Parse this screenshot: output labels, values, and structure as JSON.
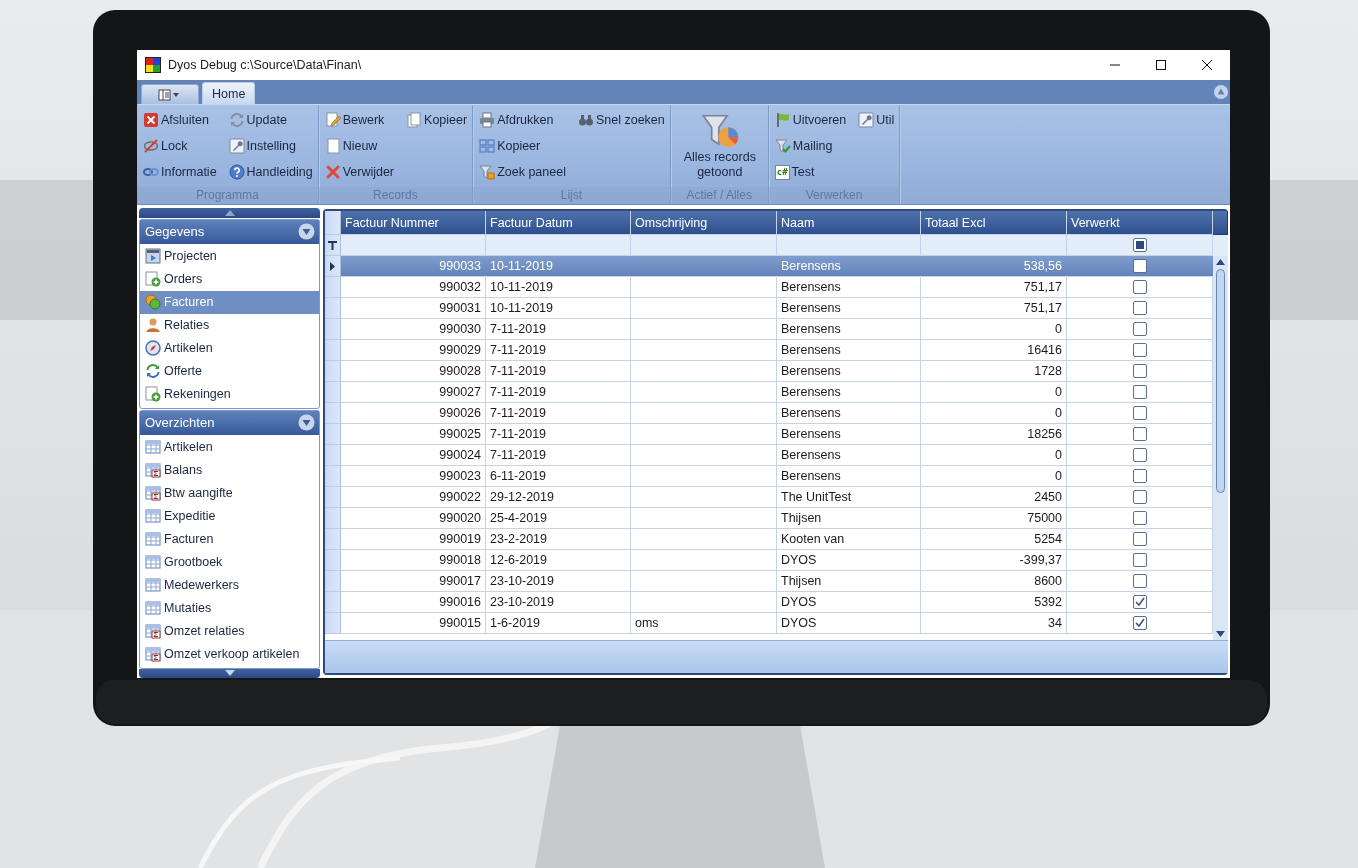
{
  "window": {
    "title": "Dyos Debug c:\\Source\\Data\\Finan\\"
  },
  "ribbon": {
    "tabs": [
      {
        "label": "Home",
        "selected": true
      }
    ],
    "groups": [
      {
        "label": "Programma",
        "columns": [
          [
            {
              "label": "Afsluiten",
              "kind": "delete"
            },
            {
              "label": "Lock",
              "kind": "crossed-eye"
            },
            {
              "label": "Informatie",
              "kind": "chain"
            }
          ],
          [
            {
              "label": "Update",
              "kind": "refresh"
            },
            {
              "label": "Instelling",
              "kind": "wrench"
            },
            {
              "label": "Handleiding",
              "kind": "help"
            }
          ]
        ]
      },
      {
        "label": "Records",
        "columns": [
          [
            {
              "label": "Bewerk",
              "kind": "edit"
            },
            {
              "label": "Nieuw",
              "kind": "page"
            },
            {
              "label": "Verwijder",
              "kind": "cross"
            }
          ],
          [
            {
              "label": "Kopieer",
              "kind": "copy"
            }
          ]
        ]
      },
      {
        "label": "Lijst",
        "columns": [
          [
            {
              "label": "Afdrukken",
              "kind": "printer"
            },
            {
              "label": "Kopieer",
              "kind": "tiles"
            },
            {
              "label": "Zoek paneel",
              "kind": "funnel"
            }
          ],
          [
            {
              "label": "Snel zoeken",
              "kind": "binoculars"
            }
          ]
        ]
      },
      {
        "label": "Actief / Alles",
        "large": {
          "label": "Alles records getoond",
          "kind": "funnel-chart"
        }
      },
      {
        "label": "Verwerken",
        "columns": [
          [
            {
              "label": "Uitvoeren",
              "kind": "flag"
            },
            {
              "label": "Mailing",
              "kind": "funnel-check"
            },
            {
              "label": "Test",
              "kind": "code",
              "icon_text": "c#"
            }
          ],
          [
            {
              "label": "Util",
              "kind": "wrench"
            }
          ]
        ]
      }
    ]
  },
  "sidebar": {
    "sections": [
      {
        "title": "Gegevens",
        "items": [
          {
            "label": "Projecten",
            "kind": "film",
            "selected": false
          },
          {
            "label": "Orders",
            "kind": "add-page",
            "selected": false
          },
          {
            "label": "Facturen",
            "kind": "coins",
            "selected": true
          },
          {
            "label": "Relaties",
            "kind": "person",
            "selected": false
          },
          {
            "label": "Artikelen",
            "kind": "compass",
            "selected": false
          },
          {
            "label": "Offerte",
            "kind": "sync",
            "selected": false
          },
          {
            "label": "Rekeningen",
            "kind": "add-page",
            "selected": false
          }
        ]
      },
      {
        "title": "Overzichten",
        "items": [
          {
            "label": "Artikelen",
            "kind": "table",
            "selected": false
          },
          {
            "label": "Balans",
            "kind": "sum-table",
            "selected": false
          },
          {
            "label": "Btw aangifte",
            "kind": "sum-table",
            "selected": false
          },
          {
            "label": "Expeditie",
            "kind": "table",
            "selected": false
          },
          {
            "label": "Facturen",
            "kind": "table",
            "selected": false
          },
          {
            "label": "Grootboek",
            "kind": "table",
            "selected": false
          },
          {
            "label": "Medewerkers",
            "kind": "table",
            "selected": false
          },
          {
            "label": "Mutaties",
            "kind": "table",
            "selected": false
          },
          {
            "label": "Omzet relaties",
            "kind": "sum-table",
            "selected": false
          },
          {
            "label": "Omzet verkoop artikelen",
            "kind": "sum-table",
            "selected": false
          }
        ]
      }
    ]
  },
  "table": {
    "columns": [
      "Factuur Nummer",
      "Factuur Datum",
      "Omschrijving",
      "Naam",
      "Totaal Excl",
      "Verwerkt"
    ],
    "filter": {
      "verwerkt": {
        "indeterminate": true
      }
    },
    "rows": [
      {
        "number": "990033",
        "date": "10-11-2019",
        "description": "",
        "name": "Berensens",
        "total": "538,56",
        "processed": false,
        "selected": true
      },
      {
        "number": "990032",
        "date": "10-11-2019",
        "description": "",
        "name": "Berensens",
        "total": "751,17",
        "processed": false,
        "selected": false
      },
      {
        "number": "990031",
        "date": "10-11-2019",
        "description": "",
        "name": "Berensens",
        "total": "751,17",
        "processed": false,
        "selected": false
      },
      {
        "number": "990030",
        "date": "7-11-2019",
        "description": "",
        "name": "Berensens",
        "total": "0",
        "processed": false,
        "selected": false
      },
      {
        "number": "990029",
        "date": "7-11-2019",
        "description": "",
        "name": "Berensens",
        "total": "16416",
        "processed": false,
        "selected": false
      },
      {
        "number": "990028",
        "date": "7-11-2019",
        "description": "",
        "name": "Berensens",
        "total": "1728",
        "processed": false,
        "selected": false
      },
      {
        "number": "990027",
        "date": "7-11-2019",
        "description": "",
        "name": "Berensens",
        "total": "0",
        "processed": false,
        "selected": false
      },
      {
        "number": "990026",
        "date": "7-11-2019",
        "description": "",
        "name": "Berensens",
        "total": "0",
        "processed": false,
        "selected": false
      },
      {
        "number": "990025",
        "date": "7-11-2019",
        "description": "",
        "name": "Berensens",
        "total": "18256",
        "processed": false,
        "selected": false
      },
      {
        "number": "990024",
        "date": "7-11-2019",
        "description": "",
        "name": "Berensens",
        "total": "0",
        "processed": false,
        "selected": false
      },
      {
        "number": "990023",
        "date": "6-11-2019",
        "description": "",
        "name": "Berensens",
        "total": "0",
        "processed": false,
        "selected": false
      },
      {
        "number": "990022",
        "date": "29-12-2019",
        "description": "",
        "name": "The UnitTest",
        "total": "2450",
        "processed": false,
        "selected": false
      },
      {
        "number": "990020",
        "date": "25-4-2019",
        "description": "",
        "name": "Thijsen",
        "total": "75000",
        "processed": false,
        "selected": false
      },
      {
        "number": "990019",
        "date": "23-2-2019",
        "description": "",
        "name": "Kooten van",
        "total": "5254",
        "processed": false,
        "selected": false
      },
      {
        "number": "990018",
        "date": "12-6-2019",
        "description": "",
        "name": "DYOS",
        "total": "-399,37",
        "processed": false,
        "selected": false
      },
      {
        "number": "990017",
        "date": "23-10-2019",
        "description": "",
        "name": "Thijsen",
        "total": "8600",
        "processed": false,
        "selected": false
      },
      {
        "number": "990016",
        "date": "23-10-2019",
        "description": "",
        "name": "DYOS",
        "total": "5392",
        "processed": true,
        "selected": false
      },
      {
        "number": "990015",
        "date": "1-6-2019",
        "description": "oms",
        "name": "DYOS",
        "total": "34",
        "processed": true,
        "selected": false
      }
    ]
  }
}
